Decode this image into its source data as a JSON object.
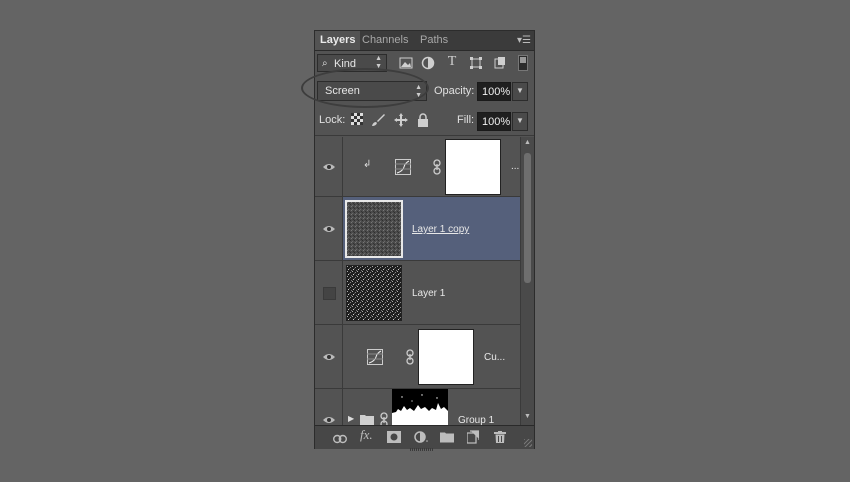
{
  "tabs": [
    {
      "label": "Layers",
      "active": true
    },
    {
      "label": "Channels",
      "active": false
    },
    {
      "label": "Paths",
      "active": false
    }
  ],
  "filter": {
    "kind_label": "Kind"
  },
  "blend": {
    "mode": "Screen",
    "opacity_label": "Opacity:",
    "opacity": "100%"
  },
  "lock": {
    "label": "Lock:",
    "fill_label": "Fill:",
    "fill": "100%"
  },
  "layers": [
    {
      "name": "...",
      "type": "curves-clipped",
      "visible": true,
      "selected": false
    },
    {
      "name": "Layer 1 copy",
      "type": "pixel",
      "visible": true,
      "selected": true
    },
    {
      "name": "Layer 1",
      "type": "pixel",
      "visible": false,
      "selected": false
    },
    {
      "name": "Cu...",
      "type": "curves",
      "visible": true,
      "selected": false
    },
    {
      "name": "Group 1",
      "type": "group",
      "visible": true,
      "selected": false
    }
  ],
  "colors": {
    "panel": "#535353",
    "selected": "#55607b",
    "background": "#646464"
  }
}
